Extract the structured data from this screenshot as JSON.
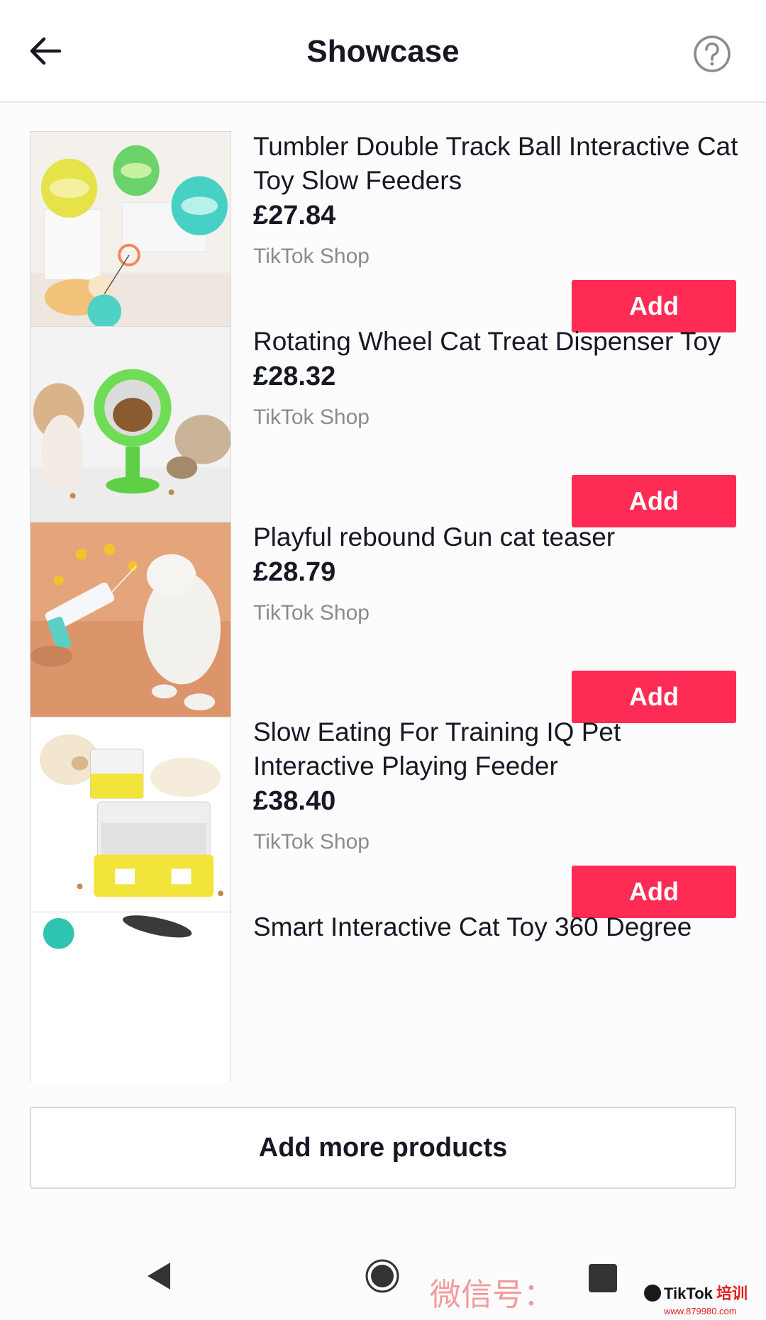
{
  "header": {
    "title": "Showcase",
    "back_icon": "arrow-left-icon",
    "help_icon": "question-circle-icon"
  },
  "products": [
    {
      "name": "Tumbler Double Track Ball Interactive Cat Toy Slow Feeders",
      "price": "£27.84",
      "seller": "TikTok Shop",
      "add_label": "Add"
    },
    {
      "name": "Rotating Wheel Cat Treat Dispenser Toy",
      "price": "£28.32",
      "seller": "TikTok Shop",
      "add_label": "Add"
    },
    {
      "name": "Playful rebound Gun cat teaser",
      "price": "£28.79",
      "seller": "TikTok Shop",
      "add_label": "Add"
    },
    {
      "name": "Slow Eating For Training IQ Pet Interactive Playing Feeder",
      "price": "£38.40",
      "seller": "TikTok Shop",
      "add_label": "Add"
    },
    {
      "name": "Smart Interactive Cat Toy 360 Degree"
    }
  ],
  "add_more_label": "Add more products",
  "system_nav": {
    "back_icon": "triangle-back-icon",
    "home_icon": "circle-home-icon",
    "recents_icon": "square-recents-icon"
  },
  "watermark": {
    "text": "微信号：",
    "brand": "TikTok培训",
    "url": "www.879980.com"
  },
  "colors": {
    "accent": "#fe2c55",
    "text": "#161823",
    "muted": "#8a8b91"
  }
}
